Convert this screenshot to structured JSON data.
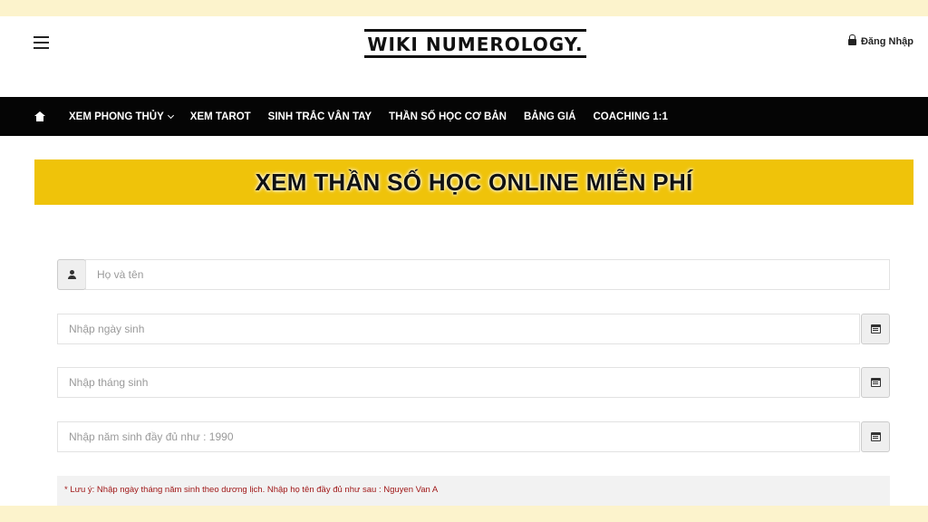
{
  "header": {
    "logo_text": "WIKI NUMEROLOGY.",
    "login_label": "Đăng Nhập",
    "icons": {
      "menu": "hamburger-icon",
      "lock": "lock-icon"
    }
  },
  "navbar": {
    "home_icon": "home-icon",
    "items": [
      {
        "label": "XEM PHONG THỦY",
        "has_dropdown": true
      },
      {
        "label": "XEM TAROT"
      },
      {
        "label": "SINH TRẮC VÂN TAY"
      },
      {
        "label": "THẦN SỐ HỌC CƠ BẢN"
      },
      {
        "label": "BẢNG GIÁ"
      },
      {
        "label": "COACHING 1:1"
      }
    ]
  },
  "banner": {
    "title": "XEM THẦN SỐ HỌC ONLINE MIỄN PHÍ",
    "color": "#efc30a"
  },
  "form": {
    "name_placeholder": "Họ và tên",
    "day_placeholder": "Nhập ngày sinh",
    "month_placeholder": "Nhập tháng sinh",
    "year_placeholder": "Nhập năm sinh đầy đủ như : 1990",
    "note": "* Lưu ý: Nhập ngày tháng năm sinh theo dương lịch. Nhập họ tên đầy đủ như sau : Nguyen Van A"
  }
}
